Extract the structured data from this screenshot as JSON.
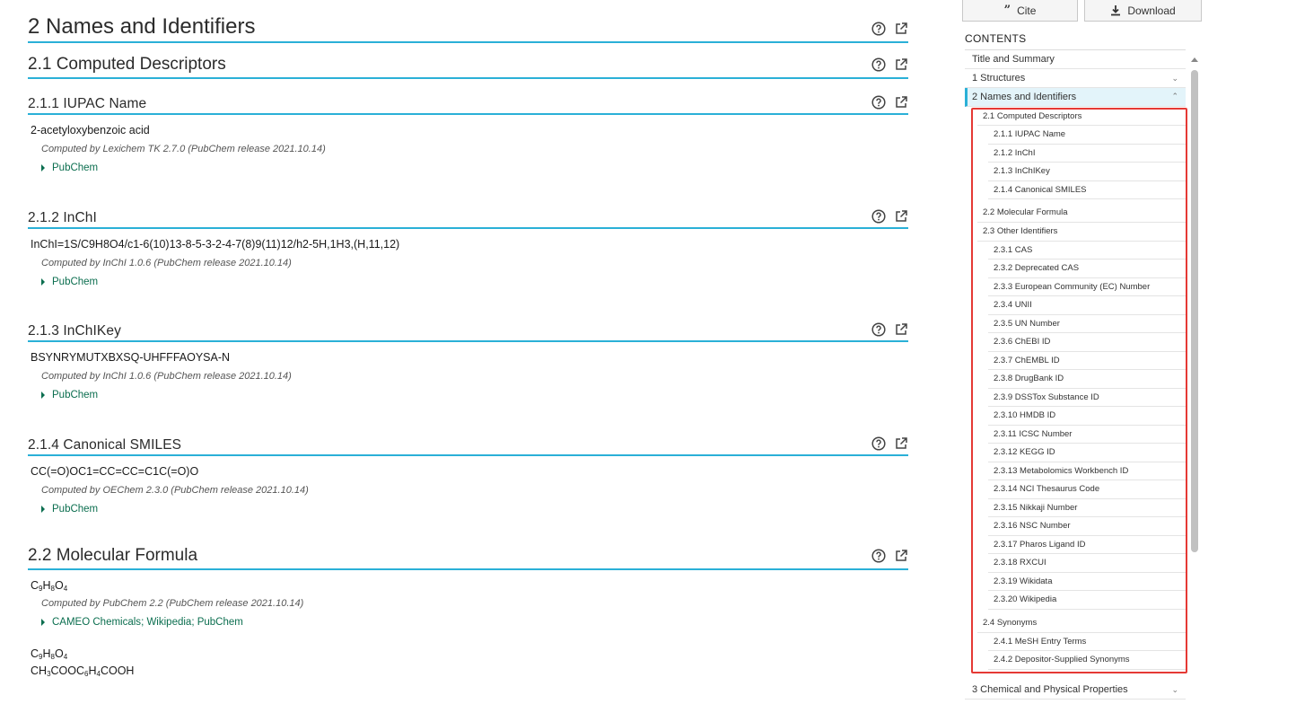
{
  "main": {
    "h_names": "2 Names and Identifiers",
    "h_computed": "2.1 Computed Descriptors",
    "iupac": {
      "heading": "2.1.1 IUPAC Name",
      "value": "2-acetyloxybenzoic acid",
      "note": "Computed by Lexichem TK 2.7.0 (PubChem release 2021.10.14)",
      "ref": "PubChem"
    },
    "inchi": {
      "heading": "2.1.2 InChI",
      "value": "InChI=1S/C9H8O4/c1-6(10)13-8-5-3-2-4-7(8)9(11)12/h2-5H,1H3,(H,11,12)",
      "note": "Computed by InChI 1.0.6 (PubChem release 2021.10.14)",
      "ref": "PubChem"
    },
    "inchikey": {
      "heading": "2.1.3 InChIKey",
      "value": "BSYNRYMUTXBXSQ-UHFFFAOYSA-N",
      "note": "Computed by InChI 1.0.6 (PubChem release 2021.10.14)",
      "ref": "PubChem"
    },
    "smiles": {
      "heading": "2.1.4 Canonical SMILES",
      "value": "CC(=O)OC1=CC=CC=C1C(=O)O",
      "note": "Computed by OEChem 2.3.0 (PubChem release 2021.10.14)",
      "ref": "PubChem"
    },
    "formula": {
      "heading": "2.2 Molecular Formula",
      "note": "Computed by PubChem 2.2 (PubChem release 2021.10.14)",
      "refs": [
        "CAMEO Chemicals",
        "Wikipedia",
        "PubChem"
      ],
      "ref_sep": "; "
    }
  },
  "sidebar": {
    "cite_label": "Cite",
    "download_label": "Download",
    "contents_title": "CONTENTS",
    "toc": {
      "title_summary": "Title and Summary",
      "structures": "1 Structures",
      "names": "2 Names and Identifiers",
      "computed": "2.1 Computed Descriptors",
      "computed_items": [
        "2.1.1 IUPAC Name",
        "2.1.2 InChI",
        "2.1.3 InChIKey",
        "2.1.4 Canonical SMILES"
      ],
      "formula": "2.2 Molecular Formula",
      "other": "2.3 Other Identifiers",
      "other_items": [
        "2.3.1 CAS",
        "2.3.2 Deprecated CAS",
        "2.3.3 European Community (EC) Number",
        "2.3.4 UNII",
        "2.3.5 UN Number",
        "2.3.6 ChEBI ID",
        "2.3.7 ChEMBL ID",
        "2.3.8 DrugBank ID",
        "2.3.9 DSSTox Substance ID",
        "2.3.10 HMDB ID",
        "2.3.11 ICSC Number",
        "2.3.12 KEGG ID",
        "2.3.13 Metabolomics Workbench ID",
        "2.3.14 NCI Thesaurus Code",
        "2.3.15 Nikkaji Number",
        "2.3.16 NSC Number",
        "2.3.17 Pharos Ligand ID",
        "2.3.18 RXCUI",
        "2.3.19 Wikidata",
        "2.3.20 Wikipedia"
      ],
      "synonyms": "2.4 Synonyms",
      "synonyms_items": [
        "2.4.1 MeSH Entry Terms",
        "2.4.2 Depositor-Supplied Synonyms"
      ],
      "chemphys": "3 Chemical and Physical Properties"
    }
  },
  "colors": {
    "accent": "#2ab0d7",
    "link": "#0b6e4f",
    "highlight": "#e53935"
  }
}
